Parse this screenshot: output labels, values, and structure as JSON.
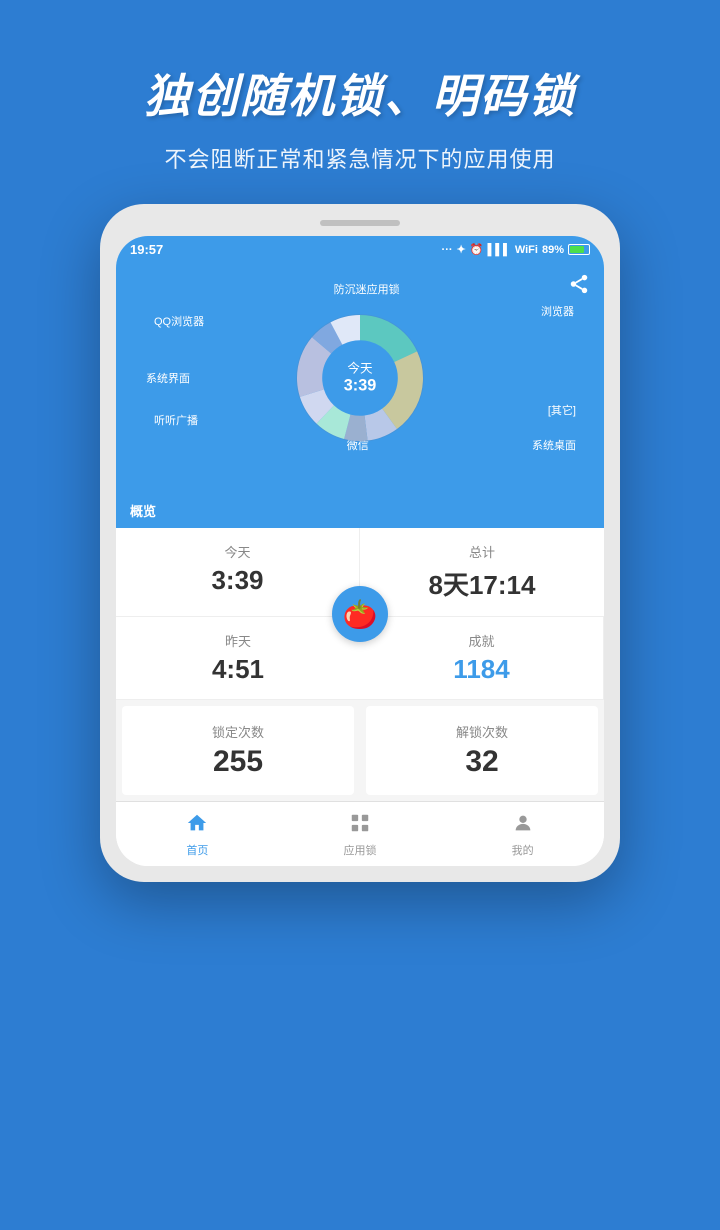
{
  "header": {
    "title": "独创随机锁、明码锁",
    "subtitle": "不会阻断正常和紧急情况下的应用使用"
  },
  "statusBar": {
    "time": "19:57",
    "battery": "89%",
    "signal": "···"
  },
  "shareIcon": "⬆",
  "chart": {
    "centerLabel": "今天",
    "centerTime": "3:39",
    "tab": "概览",
    "segments": [
      {
        "label": "防沉迷应用锁",
        "color": "#5cc8c0",
        "percent": 18
      },
      {
        "label": "浏览器",
        "color": "#c8c89e",
        "percent": 22
      },
      {
        "label": "[其它]",
        "color": "#b8c8e8",
        "percent": 8
      },
      {
        "label": "系统桌面",
        "color": "#9ab0d0",
        "percent": 6
      },
      {
        "label": "微信",
        "color": "#a8e8d8",
        "percent": 8
      },
      {
        "label": "听听广播",
        "color": "#d0d8f0",
        "percent": 8
      },
      {
        "label": "系统界面",
        "color": "#b8c0e0",
        "percent": 16
      },
      {
        "label": "QQ浏览器",
        "color": "#80a8e0",
        "percent": 6
      },
      {
        "label": "其他",
        "color": "#e0e8f8",
        "percent": 8
      }
    ]
  },
  "stats": {
    "today_label": "今天",
    "today_value": "3:39",
    "total_label": "总计",
    "total_value": "8天17:14",
    "yesterday_label": "昨天",
    "yesterday_value": "4:51",
    "achievement_label": "成就",
    "achievement_value": "1184"
  },
  "lockStats": {
    "lock_label": "锁定次数",
    "lock_value": "255",
    "unlock_label": "解锁次数",
    "unlock_value": "32"
  },
  "bottomNav": {
    "items": [
      {
        "label": "首页",
        "icon": "home",
        "active": true
      },
      {
        "label": "应用锁",
        "icon": "grid",
        "active": false
      },
      {
        "label": "我的",
        "icon": "person",
        "active": false
      }
    ]
  }
}
